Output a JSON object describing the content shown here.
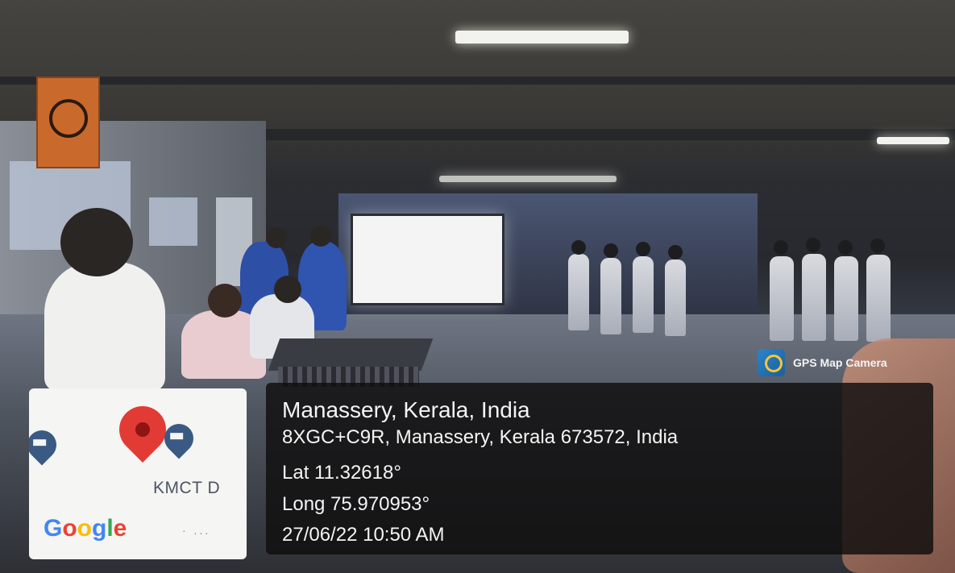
{
  "overlay": {
    "app_badge": "GPS Map Camera",
    "place_title": "Manassery, Kerala, India",
    "address": "8XGC+C9R, Manassery, Kerala 673572, India",
    "latitude": "Lat 11.32618°",
    "longitude": "Long 75.970953°",
    "datetime": "27/06/22 10:50 AM"
  },
  "map_thumbnail": {
    "place_label": "KMCT D",
    "brand_logo": "Google",
    "brand_letters": [
      {
        "char": "G",
        "color": "#4285F4"
      },
      {
        "char": "o",
        "color": "#EA4335"
      },
      {
        "char": "o",
        "color": "#FBBC05"
      },
      {
        "char": "g",
        "color": "#4285F4"
      },
      {
        "char": "l",
        "color": "#34A853"
      },
      {
        "char": "e",
        "color": "#EA4335"
      }
    ],
    "pins": [
      "red-location-pin-icon",
      "graduation-cap-pin-icon",
      "graduation-cap-pin-icon"
    ]
  },
  "colors": {
    "overlay_bg": "#0f0e0e",
    "pin_red": "#e23b35",
    "pin_blue": "#3a5a84"
  }
}
